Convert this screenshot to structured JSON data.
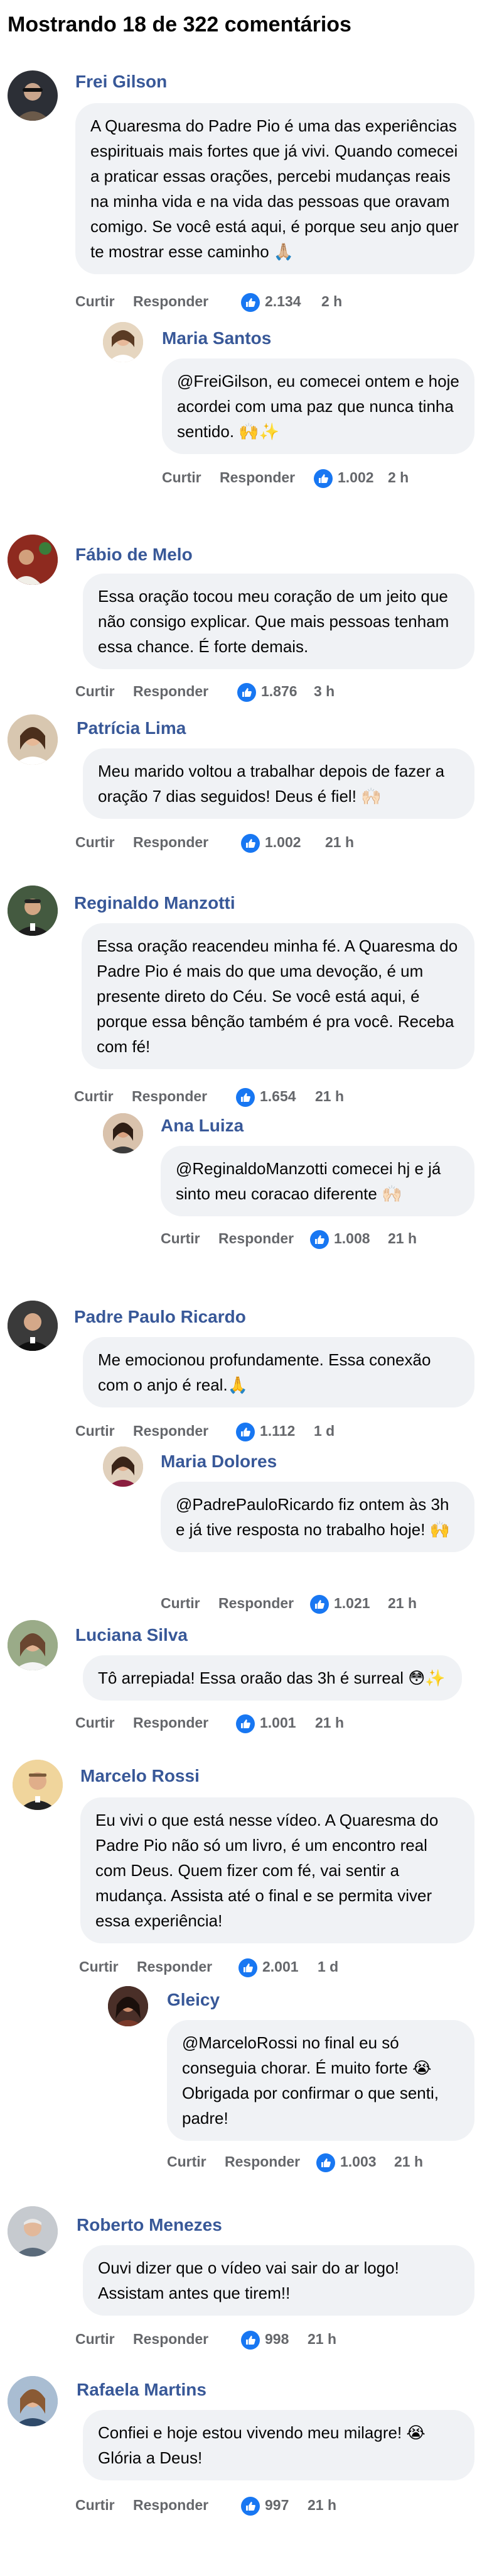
{
  "header": {
    "title": "Mostrando 18 de 322 comentários"
  },
  "actions": {
    "like_label": "Curtir",
    "reply_label": "Responder"
  },
  "comments": [
    {
      "author": "Frei Gilson",
      "text": "A Quaresma do Padre Pio é uma das experiências espirituais mais fortes que já vivi. Quando comecei a praticar essas orações, percebi mudanças reais na minha vida e na vida das pessoas que oravam comigo. Se você está aqui, é porque seu anjo quer te mostrar esse caminho 🙏🏼",
      "likes": "2.134",
      "time": "2 h"
    },
    {
      "author": "Maria Santos",
      "text": "@FreiGilson, eu comecei ontem e hoje acordei com uma paz que nunca tinha sentido. 🙌✨",
      "likes": "1.002",
      "time": "2 h"
    },
    {
      "author": "Fábio de Melo",
      "text": "Essa oração tocou meu coração de um jeito que não consigo explicar. Que mais pessoas tenham essa chance. É forte demais.",
      "likes": "1.876",
      "time": "3 h"
    },
    {
      "author": "Patrícia Lima",
      "text": "Meu marido voltou a trabalhar depois de fazer a oração 7 dias seguidos! Deus é fiel! 🙌🏻",
      "likes": "1.002",
      "time": "21 h"
    },
    {
      "author": "Reginaldo Manzotti",
      "text": "Essa oração reacendeu minha fé. A Quaresma do Padre Pio é mais do que uma devoção, é um presente direto do Céu. Se você está aqui, é porque essa bênção também é pra você. Receba com fé!",
      "likes": "1.654",
      "time": "21 h"
    },
    {
      "author": "Ana Luiza",
      "text": "@ReginaldoManzotti comecei hj e já sinto meu coracao diferente 🙌🏻",
      "likes": "1.008",
      "time": "21 h"
    },
    {
      "author": "Padre Paulo Ricardo",
      "text": "Me emocionou profundamente. Essa conexão com o anjo é real.🙏",
      "likes": "1.112",
      "time": "1 d"
    },
    {
      "author": "Maria Dolores",
      "text": "@PadrePauloRicardo fiz ontem às 3h e já tive resposta no trabalho hoje! 🙌",
      "likes": "1.021",
      "time": "21 h"
    },
    {
      "author": "Luciana Silva",
      "text": "Tô arrepiada! Essa oraão das 3h é surreal 😳✨",
      "likes": "1.001",
      "time": "21 h"
    },
    {
      "author": "Marcelo Rossi",
      "text": "Eu vivi o que está nesse vídeo. A Quaresma do Padre Pio não só um livro, é um encontro real com Deus. Quem fizer com fé, vai sentir a mudança. Assista até o final e se permita viver essa experiência!",
      "likes": "2.001",
      "time": "1 d"
    },
    {
      "author": "Gleicy",
      "text": "@MarceloRossi no final eu só conseguia chorar. É muito forte 😭 Obrigada por confirmar o que senti, padre!",
      "likes": "1.003",
      "time": "21 h"
    },
    {
      "author": "Roberto Menezes",
      "text": "Ouvi dizer que o vídeo vai sair do ar logo! Assistam antes que tirem!!",
      "likes": "998",
      "time": "21 h"
    },
    {
      "author": "Rafaela Martins",
      "text": "Confiei e hoje estou vivendo meu milagre! 😭 Glória a Deus!",
      "likes": "997",
      "time": "21 h"
    }
  ]
}
